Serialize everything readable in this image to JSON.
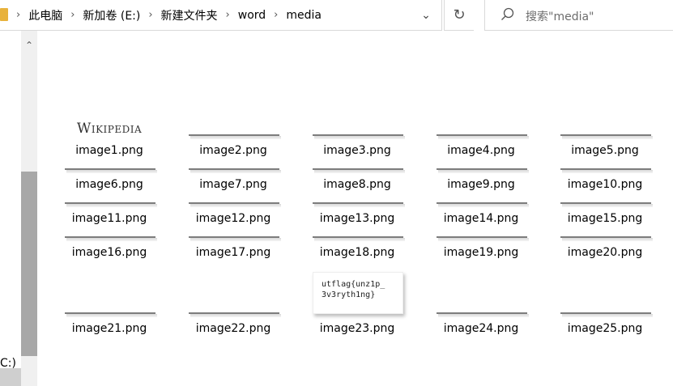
{
  "breadcrumb": [
    "此电脑",
    "新加卷 (E:)",
    "新建文件夹",
    "word",
    "media"
  ],
  "search": {
    "placeholder": "搜索\"media\""
  },
  "nav": {
    "partial_label": "C:)"
  },
  "files": [
    {
      "name": "image1.png",
      "thumb": "wikipedia",
      "thumb_text": "Wikipedia"
    },
    {
      "name": "image2.png",
      "thumb": "bar"
    },
    {
      "name": "image3.png",
      "thumb": "bar"
    },
    {
      "name": "image4.png",
      "thumb": "bar"
    },
    {
      "name": "image5.png",
      "thumb": "bar"
    },
    {
      "name": "image6.png",
      "thumb": "bar"
    },
    {
      "name": "image7.png",
      "thumb": "bar"
    },
    {
      "name": "image8.png",
      "thumb": "bar"
    },
    {
      "name": "image9.png",
      "thumb": "bar"
    },
    {
      "name": "image10.png",
      "thumb": "bar"
    },
    {
      "name": "image11.png",
      "thumb": "bar"
    },
    {
      "name": "image12.png",
      "thumb": "bar"
    },
    {
      "name": "image13.png",
      "thumb": "bar"
    },
    {
      "name": "image14.png",
      "thumb": "bar"
    },
    {
      "name": "image15.png",
      "thumb": "bar"
    },
    {
      "name": "image16.png",
      "thumb": "bar"
    },
    {
      "name": "image17.png",
      "thumb": "bar"
    },
    {
      "name": "image18.png",
      "thumb": "bar"
    },
    {
      "name": "image19.png",
      "thumb": "bar"
    },
    {
      "name": "image20.png",
      "thumb": "bar"
    },
    {
      "name": "image21.png",
      "thumb": "bar"
    },
    {
      "name": "image22.png",
      "thumb": "bar"
    },
    {
      "name": "image23.png",
      "thumb": "flag",
      "thumb_text": "utflag{unz1p_\n3v3ryth1ng}"
    },
    {
      "name": "image24.png",
      "thumb": "bar"
    },
    {
      "name": "image25.png",
      "thumb": "bar"
    }
  ]
}
